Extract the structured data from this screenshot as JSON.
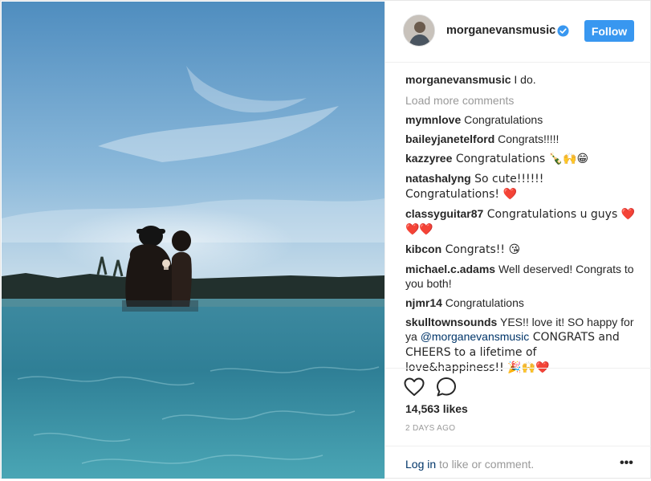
{
  "post": {
    "username": "morganevansmusic",
    "follow_label": "Follow",
    "caption_user": "morganevansmusic",
    "caption_text": " I do.",
    "load_more": "Load more comments",
    "likes": "14,563 likes",
    "time": "2 DAYS AGO",
    "login_link": "Log in",
    "login_rest": " to like or comment.",
    "more_label": "•••"
  },
  "comments": [
    {
      "user": "mymnlove",
      "text": " Congratulations"
    },
    {
      "user": "baileyjanetelford",
      "text": " Congrats!!!!!"
    },
    {
      "user": "kazzyree",
      "text": " Congratulations 🍾🙌😁"
    },
    {
      "user": "natashalyng",
      "text": " So cute!!!!!! Congratulations! ❤️"
    },
    {
      "user": "classyguitar87",
      "text": " Congratulations u guys ❤️❤️❤️"
    },
    {
      "user": "kibcon",
      "text": " Congrats!! 😘"
    },
    {
      "user": "michael.c.adams",
      "text": " Well deserved! Congrats to you both!"
    },
    {
      "user": "njmr14",
      "text": " Congratulations"
    },
    {
      "user": "skulltownsounds",
      "text_a": " YES!! love it! SO happy for ya ",
      "mention": "@morganevansmusic",
      "text_b": " CONGRATS and CHEERS to a lifetime of love&happiness!! 🎉🙌❤️"
    }
  ],
  "icons": {
    "verified": "verified-badge-icon",
    "like": "heart-icon",
    "comment": "comment-bubble-icon",
    "more": "more-dots-icon"
  },
  "colors": {
    "follow_button": "#3897f0",
    "verified": "#3897f0",
    "link": "#003569",
    "muted": "#999999"
  }
}
